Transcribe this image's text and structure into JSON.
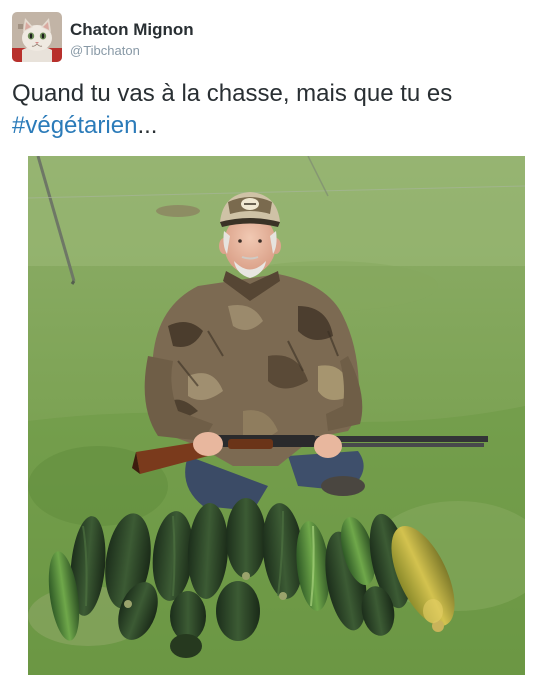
{
  "tweet": {
    "display_name": "Chaton Mignon",
    "handle": "@Tibchaton",
    "text_before": "Quand tu vas à la chasse, mais que tu es",
    "hashtag": "#végétarien",
    "text_after": "...",
    "avatar_icon": "cat-avatar",
    "photo_icon": "hunter-with-zucchinis-photo"
  },
  "colors": {
    "text": "#292f33",
    "handle": "#8899a6",
    "hashtag": "#2b7bb9"
  }
}
